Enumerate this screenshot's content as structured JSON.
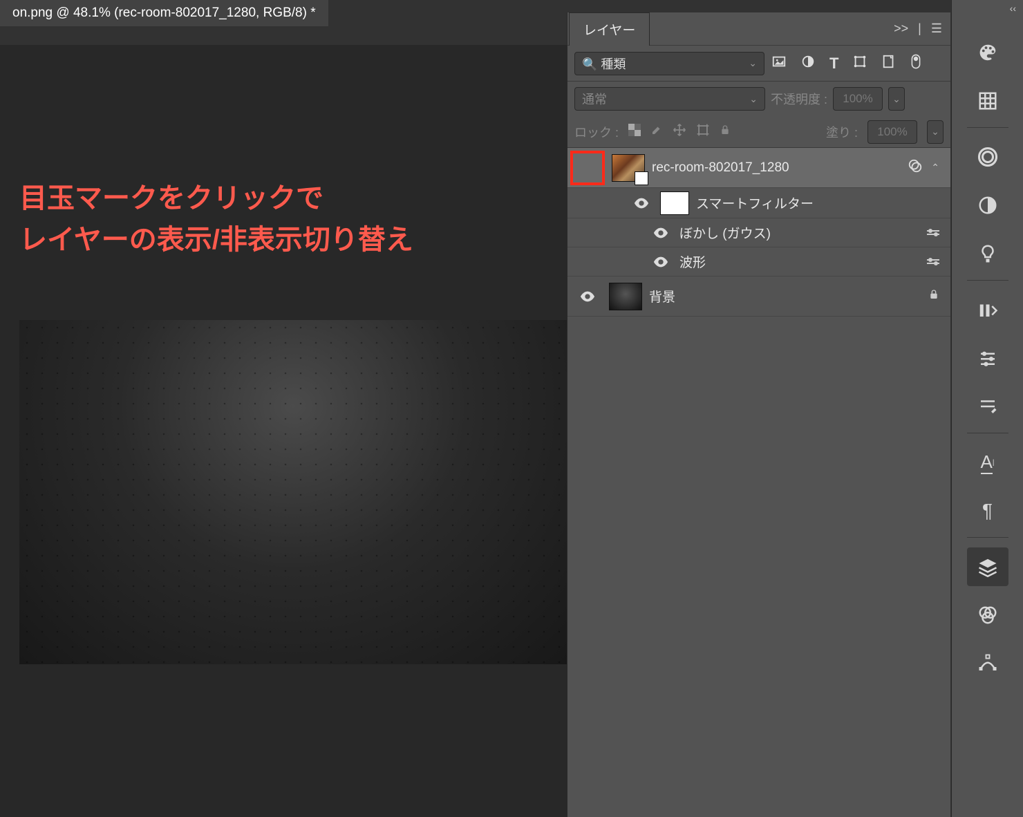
{
  "document": {
    "tab_title": "on.png @ 48.1% (rec-room-802017_1280, RGB/8) *"
  },
  "annotation": {
    "line1": "目玉マークをクリックで",
    "line2": "レイヤーの表示/非表示切り替え"
  },
  "panel": {
    "title": "レイヤー",
    "expand_label": ">>",
    "filter_label": "種類",
    "blend_mode": "通常",
    "opacity_label": "不透明度 :",
    "opacity_value": "100%",
    "lock_label": "ロック :",
    "fill_label": "塗り :",
    "fill_value": "100%"
  },
  "layers": [
    {
      "name": "rec-room-802017_1280",
      "visible_hidden_highlight": true
    },
    {
      "name": "スマートフィルター"
    },
    {
      "name": "ぼかし (ガウス)"
    },
    {
      "name": "波形"
    },
    {
      "name": "背景"
    }
  ]
}
